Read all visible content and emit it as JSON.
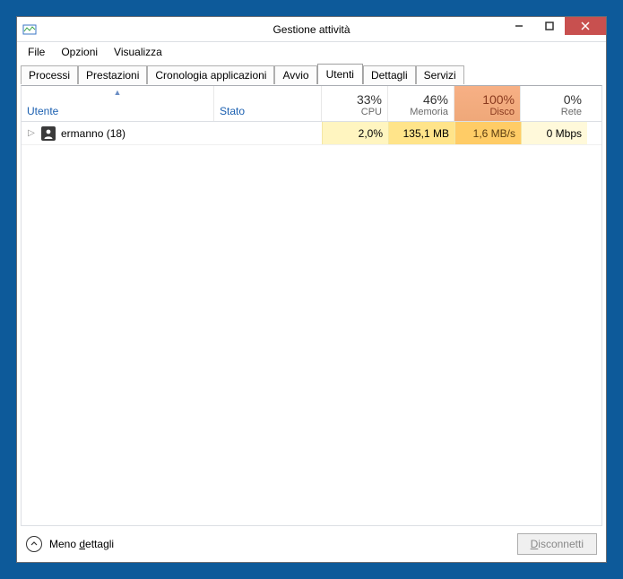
{
  "window": {
    "title": "Gestione attività"
  },
  "menu": {
    "file": "File",
    "options": "Opzioni",
    "view": "Visualizza"
  },
  "tabs": {
    "processi": "Processi",
    "prestazioni": "Prestazioni",
    "cronologia": "Cronologia applicazioni",
    "avvio": "Avvio",
    "utenti": "Utenti",
    "dettagli": "Dettagli",
    "servizi": "Servizi"
  },
  "headers": {
    "utente": "Utente",
    "stato": "Stato",
    "cpu": {
      "pct": "33%",
      "label": "CPU"
    },
    "mem": {
      "pct": "46%",
      "label": "Memoria"
    },
    "disk": {
      "pct": "100%",
      "label": "Disco"
    },
    "net": {
      "pct": "0%",
      "label": "Rete"
    }
  },
  "rows": [
    {
      "name": "ermanno (18)",
      "state": "",
      "cpu": "2,0%",
      "mem": "135,1 MB",
      "disk": "1,6 MB/s",
      "net": "0 Mbps"
    }
  ],
  "footer": {
    "less_details_pre": "Meno ",
    "less_details_u": "d",
    "less_details_post": "ettagli",
    "disconnect_u": "D",
    "disconnect_post": "isconnetti"
  }
}
